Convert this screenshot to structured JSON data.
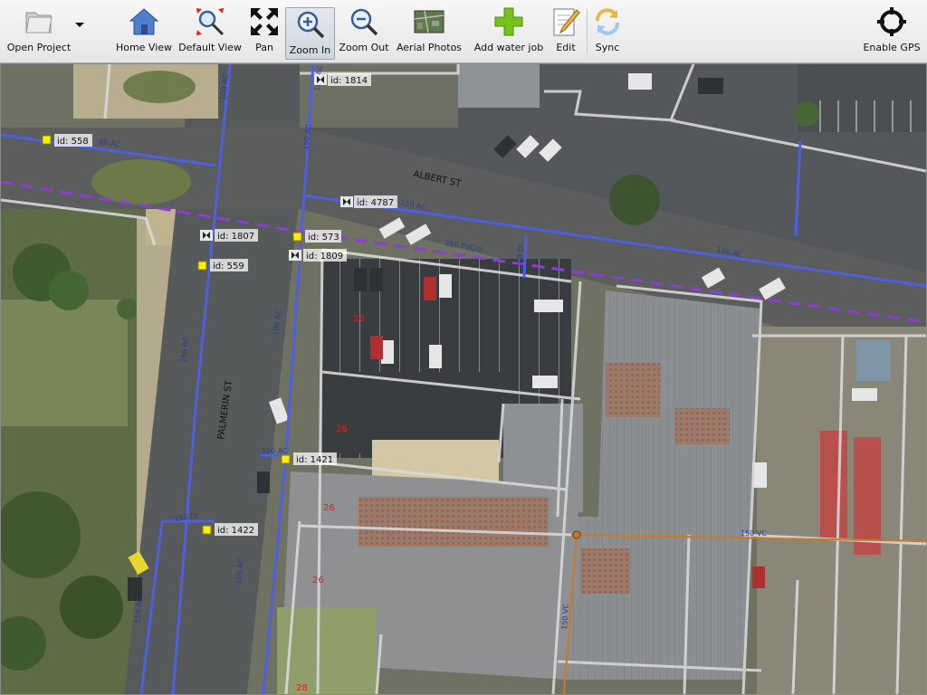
{
  "toolbar": {
    "open_project": "Open Project",
    "home_view": "Home View",
    "default_view": "Default View",
    "pan": "Pan",
    "zoom_in": "Zoom In",
    "zoom_out": "Zoom Out",
    "aerial_photos": "Aerial Photos",
    "add_water_job": "Add water job",
    "edit": "Edit",
    "sync": "Sync",
    "enable_gps": "Enable GPS"
  },
  "map": {
    "streets": {
      "albert": "ALBERT ST",
      "palmerin": "PALMERIN ST"
    },
    "features": [
      {
        "label": "id: 1814",
        "kind": "valve"
      },
      {
        "label": "id: 558",
        "kind": "hydrant"
      },
      {
        "label": "id: 4787",
        "kind": "valve"
      },
      {
        "label": "id: 1807",
        "kind": "valve"
      },
      {
        "label": "id: 573",
        "kind": "hydrant"
      },
      {
        "label": "id: 1809",
        "kind": "valve"
      },
      {
        "label": "id: 559",
        "kind": "hydrant"
      },
      {
        "label": "id: 1421",
        "kind": "hydrant"
      },
      {
        "label": "id: 1422",
        "kind": "hydrant"
      }
    ],
    "pipes": [
      "100 AC",
      "150 AC",
      "80 AC",
      "100 AC",
      "150 AC",
      "250 PVC-U",
      "100 DI",
      "150 AC",
      "150 AC",
      "100 AC",
      "100 AC",
      "150 DI",
      "100 AC",
      "150 AC",
      "150 VC",
      "150 VC"
    ],
    "numbers": [
      "26",
      "26",
      "26",
      "26",
      "28"
    ],
    "colors": {
      "water_main": "#4f5fe0",
      "trunk_main": "#8a3fd0",
      "sewer": "#c87a2a",
      "cadastre": "#d8d8d8",
      "hydrant": "#ffef00"
    }
  }
}
